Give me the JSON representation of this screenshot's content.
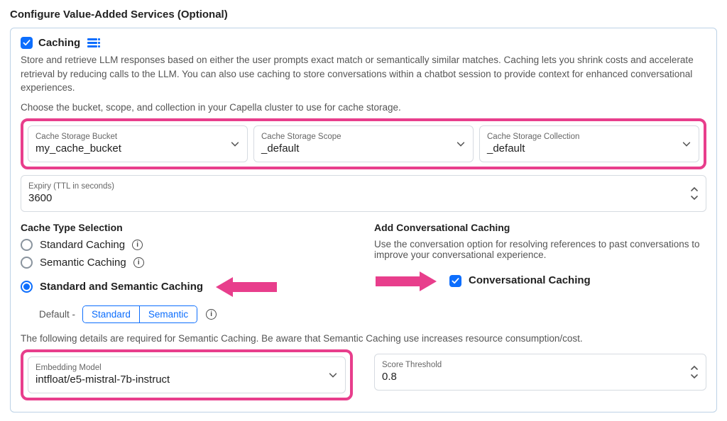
{
  "page_title": "Configure Value-Added Services (Optional)",
  "caching": {
    "checked": true,
    "title": "Caching",
    "description": "Store and retrieve LLM responses based on either the user prompts exact match or semantically similar matches. Caching lets you shrink costs and accelerate retrieval by reducing calls to the LLM. You can also use caching to store conversations within a chatbot session to provide context for enhanced conversational experiences.",
    "choose_hint": "Choose the bucket, scope, and collection in your Capella cluster to use for cache storage."
  },
  "storage": {
    "bucket": {
      "label": "Cache Storage Bucket",
      "value": "my_cache_bucket"
    },
    "scope": {
      "label": "Cache Storage Scope",
      "value": "_default"
    },
    "collection": {
      "label": "Cache Storage Collection",
      "value": "_default"
    }
  },
  "expiry": {
    "label": "Expiry (TTL in seconds)",
    "value": "3600"
  },
  "cache_type": {
    "section_title": "Cache Type Selection",
    "options": {
      "standard": "Standard Caching",
      "semantic": "Semantic Caching",
      "both": "Standard and Semantic Caching"
    },
    "default_label": "Default -",
    "seg_standard": "Standard",
    "seg_semantic": "Semantic"
  },
  "conversational": {
    "section_title": "Add Conversational Caching",
    "desc": "Use the conversation option for resolving references to past conversations to improve your conversational experience.",
    "checkbox_label": "Conversational Caching",
    "checked": true
  },
  "semantic_note": "The following details are required for Semantic Caching. Be aware that Semantic Caching use increases resource consumption/cost.",
  "embedding": {
    "label": "Embedding Model",
    "value": "intfloat/e5-mistral-7b-instruct"
  },
  "score": {
    "label": "Score Threshold",
    "value": "0.8"
  },
  "colors": {
    "accent": "#0d6efd",
    "highlight": "#e83e8c"
  }
}
